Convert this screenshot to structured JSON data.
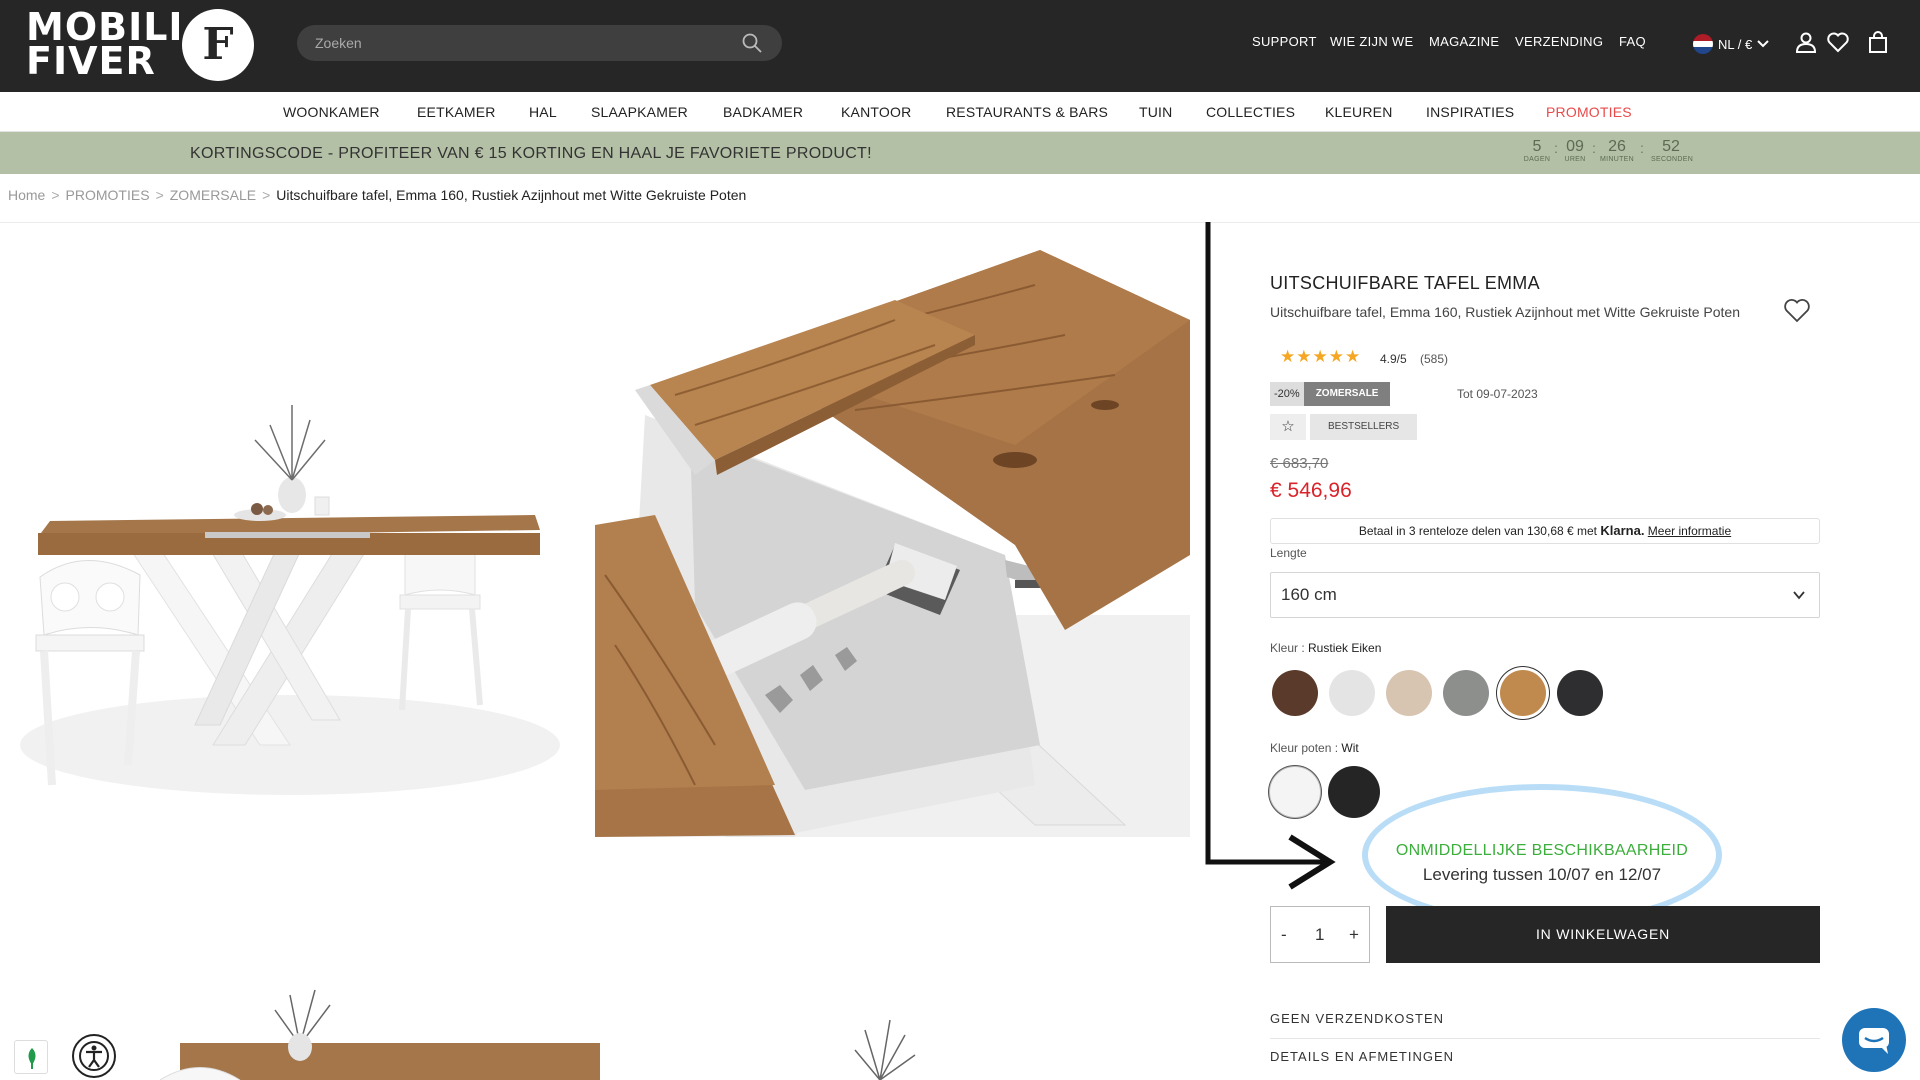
{
  "header": {
    "logo_line1": "MOBILI",
    "logo_line2": "FIVER",
    "logo_mark": "F",
    "search_placeholder": "Zoeken",
    "nav": [
      "SUPPORT",
      "WIE ZIJN WE",
      "MAGAZINE",
      "VERZENDING",
      "FAQ"
    ],
    "lang": "NL / €",
    "icons": [
      "user-icon",
      "heart-icon",
      "cart-icon"
    ]
  },
  "categories": [
    "WOONKAMER",
    "EETKAMER",
    "HAL",
    "SLAAPKAMER",
    "BADKAMER",
    "KANTOOR",
    "RESTAURANTS & BARS",
    "TUIN",
    "COLLECTIES",
    "KLEUREN",
    "INSPIRATIES",
    "PROMOTIES"
  ],
  "banner": {
    "message": "KORTINGSCODE - PROFITEER VAN € 15 KORTING EN HAAL JE FAVORIETE PRODUCT!",
    "countdown": [
      {
        "value": "5",
        "unit": "DAGEN"
      },
      {
        "value": "09",
        "unit": "UREN"
      },
      {
        "value": "26",
        "unit": "MINUTEN"
      },
      {
        "value": "52",
        "unit": "SECONDEN"
      }
    ]
  },
  "breadcrumb": [
    "Home",
    "PROMOTIES",
    "ZOMERSALE",
    "Uitschuifbare tafel, Emma 160, Rustiek Azijnhout met Witte Gekruiste Poten"
  ],
  "product": {
    "title": "UITSCHUIFBARE TAFEL EMMA",
    "subtitle": "Uitschuifbare tafel, Emma 160, Rustiek Azijnhout met Witte Gekruiste Poten",
    "stars": "★★★★★",
    "rating": "4.9/5",
    "reviews": "(585)",
    "discount": "-20%",
    "sale_tag": "ZOMERSALE",
    "until": "Tot 09-07-2023",
    "bestsellers": "BESTSELLERS",
    "old_price": "€ 683,70",
    "new_price": "€ 546,96",
    "klarna_text": "Betaal in 3 renteloze delen van 130,68 € met",
    "klarna_brand": "Klarna.",
    "klarna_more": "Meer informatie",
    "length_label": "Lengte",
    "length_value": "160 cm",
    "color_label": "Kleur : ",
    "color_value": "Rustiek Eiken",
    "colors": [
      "#5a3a2a",
      "#e4e4e4",
      "#d7c4b1",
      "#8d8f8d",
      "#c08a4f",
      "#2e2e30"
    ],
    "legs_label": "Kleur poten : ",
    "legs_value": "Wit",
    "leg_colors": [
      "#f4f4f4",
      "#252525"
    ],
    "availability": "ONMIDDELLIJKE BESCHIKBAARHEID",
    "delivery": "Levering tussen 10/07 en 12/07",
    "qty_minus": "-",
    "qty": "1",
    "qty_plus": "+",
    "add_to_cart": "IN WINKELWAGEN",
    "accordion": [
      "GEEN VERZENDKOSTEN",
      "DETAILS EN AFMETINGEN"
    ]
  },
  "colors": {
    "header_bg": "#262626",
    "banner_bg": "#b3c0a5",
    "price_red": "#d9242b",
    "promo_red": "#e94a4a",
    "availability_green": "#3bae3b",
    "highlight_ellipse": "#b9ddf7",
    "chat_blue": "#1f73b7"
  }
}
